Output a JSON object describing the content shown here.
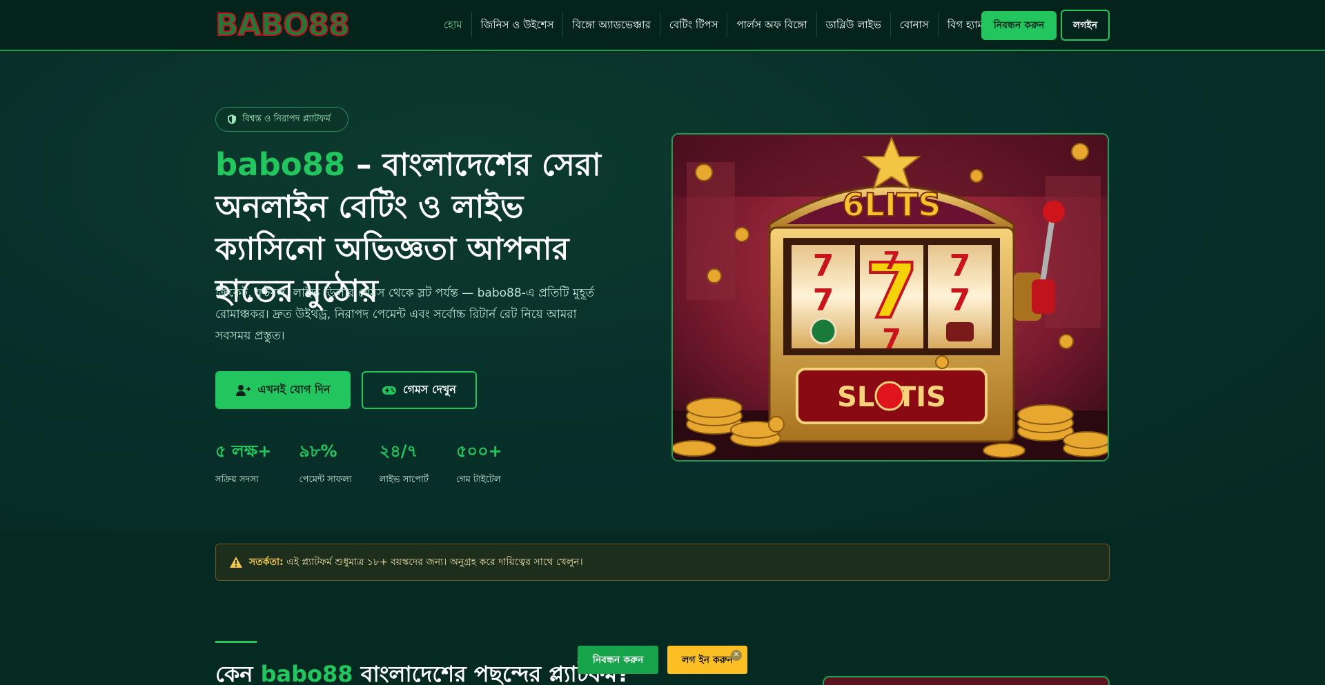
{
  "header": {
    "logo_text": "BABO88",
    "nav": [
      {
        "label": "হোম",
        "active": true
      },
      {
        "label": "জিনিস ও উইশেস"
      },
      {
        "label": "বিঙ্গো অ্যাডভেঞ্চার"
      },
      {
        "label": "বেটিং টিপস"
      },
      {
        "label": "পার্লস অফ বিঙ্গো"
      },
      {
        "label": "ডাব্লিউ লাইভ"
      },
      {
        "label": "বোনাস"
      },
      {
        "label": "বিগ হ্যামার"
      }
    ],
    "register_label": "নিবন্ধন করুন",
    "login_label": "লগইন"
  },
  "hero": {
    "badge": "বিশ্বস্ত ও নিরাপদ প্ল্যাটফর্ম",
    "title_brand": "babo88",
    "title_rest": " – বাংলাদেশের সেরা অনলাইন বেটিং ও লাইভ ক্যাসিনো অভিজ্ঞতা আপনার হাতের মুঠোয়",
    "description": "ক্রিকেট, ফুটবল, লাইভ ডিলার গেমস থেকে স্লট পর্যন্ত — babo88-এ প্রতিটি মুহূর্ত রোমাঞ্চকর। দ্রুত উইথড্র, নিরাপদ পেমেন্ট এবং সর্বোচ্চ রিটার্ন রেট নিয়ে আমরা সবসময় প্রস্তুত।",
    "join_label": "এখনই যোগ দিন",
    "games_label": "গেমস দেখুন",
    "stats": [
      {
        "value": "৫ লক্ষ+",
        "label": "সক্রিয় সদস্য"
      },
      {
        "value": "৯৮%",
        "label": "পেমেন্ট সাফল্য"
      },
      {
        "value": "২৪/৭",
        "label": "লাইভ সাপোর্ট"
      },
      {
        "value": "৫০০+",
        "label": "গেম টাইটেল"
      }
    ],
    "image_text_top": "6LITS",
    "image_text_bottom": "SLOTIS"
  },
  "warning": {
    "label": "সতর্কতা:",
    "text": " এই প্ল্যাটফর্ম শুধুমাত্র ১৮+ বয়স্কদের জন্য। অনুগ্রহ করে দায়িত্বের সাথে খেলুন।"
  },
  "section2": {
    "title_pre": "কেন ",
    "title_brand": "babo88",
    "title_post": " বাংলাদেশের পছন্দের প্ল্যাটফর্ম?"
  },
  "floating": {
    "register_label": "নিবন্ধন করুন",
    "login_label": "লগ ইন করুন",
    "close_symbol": "✕"
  },
  "colors": {
    "accent": "#22c55e",
    "background": "#062a20",
    "header_bg": "#04241b",
    "cta_yellow": "#fbbf24"
  }
}
